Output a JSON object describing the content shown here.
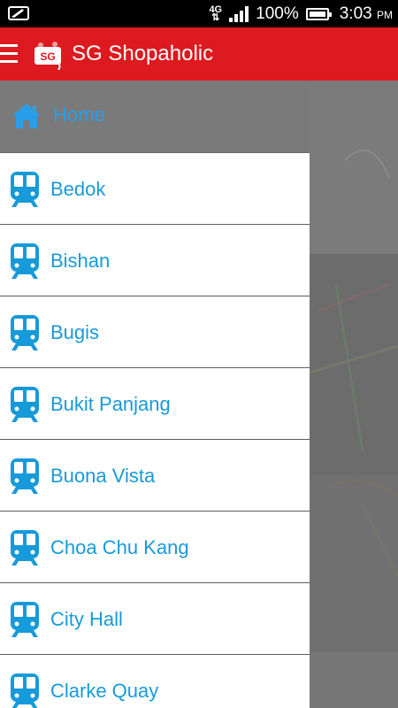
{
  "status_bar": {
    "network": "4G",
    "battery_percent": "100%",
    "time": "3:03",
    "ampm": "PM",
    "icons": [
      "screen-mirror-icon",
      "network-4g-icon",
      "signal-icon",
      "battery-icon"
    ]
  },
  "app_bar": {
    "title": "SG Shopaholic",
    "logo_text": "SG",
    "icons": [
      "hamburger-menu-icon",
      "app-logo-icon"
    ]
  },
  "drawer": {
    "home_label": "Home",
    "items": [
      {
        "label": "Bedok"
      },
      {
        "label": "Bishan"
      },
      {
        "label": "Bugis"
      },
      {
        "label": "Bukit Panjang"
      },
      {
        "label": "Buona Vista"
      },
      {
        "label": "Choa Chu Kang"
      },
      {
        "label": "City Hall"
      },
      {
        "label": "Clarke Quay"
      }
    ],
    "icons": [
      "home-icon",
      "train-icon"
    ]
  },
  "colors": {
    "app_bar": "#dd1a1f",
    "accent_blue": "#179ad9",
    "home_row": "#7a7a7a"
  }
}
